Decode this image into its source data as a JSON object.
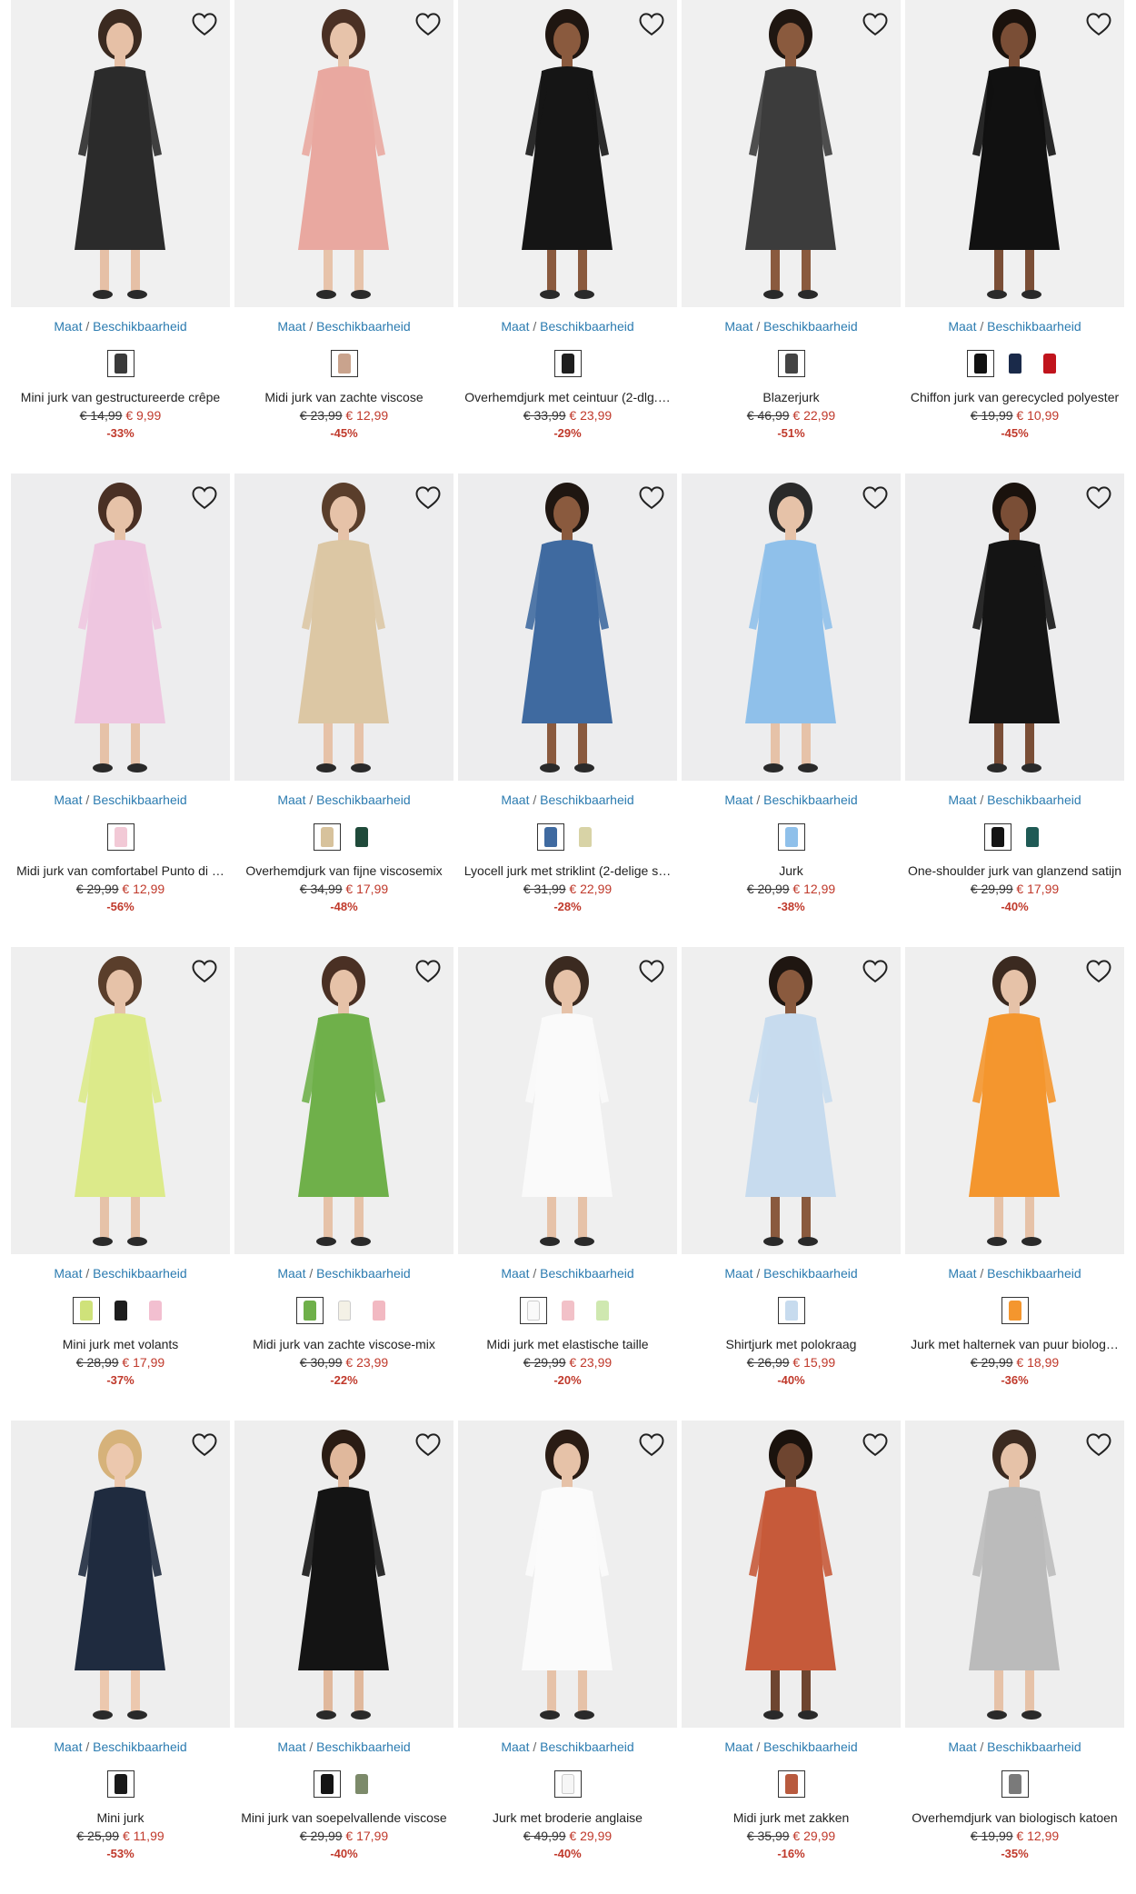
{
  "size_link": {
    "part1": "Maat",
    "sep": " / ",
    "part2": "Beschikbaarheid"
  },
  "products": [
    {
      "name": "Mini jurk van gestructureerde crêpe",
      "old": "€ 14,99",
      "new": "€ 9,99",
      "disc": "-33%",
      "bg": "#f0f0f0",
      "dress": "#2b2b2b",
      "skin": "#e6c0a6",
      "hair": "#3b2a20",
      "swatches": [
        "#3a3a3a"
      ]
    },
    {
      "name": "Midi jurk van zachte viscose",
      "old": "€ 23,99",
      "new": "€ 12,99",
      "disc": "-45%",
      "bg": "#f0f0f0",
      "dress": "#e9a8a0",
      "skin": "#e7c3aa",
      "hair": "#4a3024",
      "swatches": [
        "#c9a38d"
      ]
    },
    {
      "name": "Overhemdjurk met ceintuur (2-dlg.…",
      "old": "€ 33,99",
      "new": "€ 23,99",
      "disc": "-29%",
      "bg": "#f0f0f0",
      "dress": "#151515",
      "skin": "#8a5a3e",
      "hair": "#1f1611",
      "swatches": [
        "#1e1e1e"
      ]
    },
    {
      "name": "Blazerjurk",
      "old": "€ 46,99",
      "new": "€ 22,99",
      "disc": "-51%",
      "bg": "#f0f0f0",
      "dress": "#3c3c3c",
      "skin": "#8a5a3e",
      "hair": "#1f1611",
      "swatches": [
        "#444444"
      ]
    },
    {
      "name": "Chiffon jurk van gerecycled polyester",
      "old": "€ 19,99",
      "new": "€ 10,99",
      "disc": "-45%",
      "bg": "#f0f0f0",
      "dress": "#111111",
      "skin": "#7a4e36",
      "hair": "#1a120d",
      "swatches": [
        "#111111",
        "#1a2a4a",
        "#c0141c"
      ]
    },
    {
      "name": "Midi jurk van comfortabel Punto di …",
      "old": "€ 29,99",
      "new": "€ 12,99",
      "disc": "-56%",
      "bg": "#ededee",
      "dress": "#eec6e0",
      "skin": "#e6c2a8",
      "hair": "#4a3024",
      "swatches": [
        "#f2c9d6"
      ]
    },
    {
      "name": "Overhemdjurk van fijne viscosemix",
      "old": "€ 34,99",
      "new": "€ 17,99",
      "disc": "-48%",
      "bg": "#ededee",
      "dress": "#dcc7a4",
      "skin": "#e6c2a8",
      "hair": "#5a3e2b",
      "swatches": [
        "#d7c29c",
        "#1f4a3a"
      ]
    },
    {
      "name": "Lyocell jurk met striklint (2-delige s…",
      "old": "€ 31,99",
      "new": "€ 22,99",
      "disc": "-28%",
      "bg": "#ededee",
      "dress": "#3f6aa0",
      "skin": "#8a5a3e",
      "hair": "#1f1611",
      "swatches": [
        "#3f6aa0",
        "#d8d3a6"
      ]
    },
    {
      "name": "Jurk",
      "old": "€ 20,99",
      "new": "€ 12,99",
      "disc": "-38%",
      "bg": "#ededee",
      "dress": "#8fc0ea",
      "skin": "#e6c2a8",
      "hair": "#2a2a2a",
      "swatches": [
        "#8fc0ea"
      ]
    },
    {
      "name": "One-shoulder jurk van glanzend satijn",
      "old": "€ 29,99",
      "new": "€ 17,99",
      "disc": "-40%",
      "bg": "#ededee",
      "dress": "#141414",
      "skin": "#7a4e36",
      "hair": "#1a120d",
      "swatches": [
        "#141414",
        "#1f5a55"
      ]
    },
    {
      "name": "Mini jurk met volants",
      "old": "€ 28,99",
      "new": "€ 17,99",
      "disc": "-37%",
      "bg": "#efefef",
      "dress": "#dcea8a",
      "skin": "#e6c2a8",
      "hair": "#5a3e2b",
      "swatches": [
        "#cfe27a",
        "#1d1d1d",
        "#f2bfd0"
      ]
    },
    {
      "name": "Midi jurk van zachte viscose-mix",
      "old": "€ 30,99",
      "new": "€ 23,99",
      "disc": "-22%",
      "bg": "#efefef",
      "dress": "#6fb04a",
      "skin": "#e6c2a8",
      "hair": "#4a3024",
      "swatches": [
        "#6fb04a",
        "#f4f1e6",
        "#f2b9c2"
      ]
    },
    {
      "name": "Midi jurk met elastische taille",
      "old": "€ 29,99",
      "new": "€ 23,99",
      "disc": "-20%",
      "bg": "#efefef",
      "dress": "#fafafa",
      "skin": "#e6c2a8",
      "hair": "#3b2a20",
      "swatches": [
        "#fafafa",
        "#f2c1c8",
        "#cfe8b0"
      ]
    },
    {
      "name": "Shirtjurk met polokraag",
      "old": "€ 26,99",
      "new": "€ 15,99",
      "disc": "-40%",
      "bg": "#efefef",
      "dress": "#c7dbee",
      "skin": "#8a5a3e",
      "hair": "#1f1611",
      "swatches": [
        "#c7dbee"
      ]
    },
    {
      "name": "Jurk met halternek van puur biolog…",
      "old": "€ 29,99",
      "new": "€ 18,99",
      "disc": "-36%",
      "bg": "#efefef",
      "dress": "#f4962e",
      "skin": "#e6c2a8",
      "hair": "#3b2a20",
      "swatches": [
        "#f4962e"
      ]
    },
    {
      "name": "Mini jurk",
      "old": "€ 25,99",
      "new": "€ 11,99",
      "disc": "-53%",
      "bg": "#eeeeee",
      "dress": "#1f2b3f",
      "skin": "#ecc8ae",
      "hair": "#d6b27a",
      "swatches": [
        "#1a1a1a"
      ]
    },
    {
      "name": "Mini jurk van soepelvallende viscose",
      "old": "€ 29,99",
      "new": "€ 17,99",
      "disc": "-40%",
      "bg": "#eeeeee",
      "dress": "#141414",
      "skin": "#e0b89c",
      "hair": "#2a1c14",
      "swatches": [
        "#141414",
        "#7c8a6a"
      ]
    },
    {
      "name": "Jurk met broderie anglaise",
      "old": "€ 49,99",
      "new": "€ 29,99",
      "disc": "-40%",
      "bg": "#eeeeee",
      "dress": "#fbfbfb",
      "skin": "#e6c2a8",
      "hair": "#2a1c14",
      "swatches": [
        "#f6f6f6"
      ]
    },
    {
      "name": "Midi jurk met zakken",
      "old": "€ 35,99",
      "new": "€ 29,99",
      "disc": "-16%",
      "bg": "#eeeeee",
      "dress": "#c65a3a",
      "skin": "#6e4530",
      "hair": "#1a120d",
      "swatches": [
        "#b85a3e"
      ]
    },
    {
      "name": "Overhemdjurk van biologisch katoen",
      "old": "€ 19,99",
      "new": "€ 12,99",
      "disc": "-35%",
      "bg": "#eeeeee",
      "dress": "#bbbbbb",
      "skin": "#e6c2a8",
      "hair": "#3b2a20",
      "swatches": [
        "#7a7a7a"
      ]
    }
  ]
}
